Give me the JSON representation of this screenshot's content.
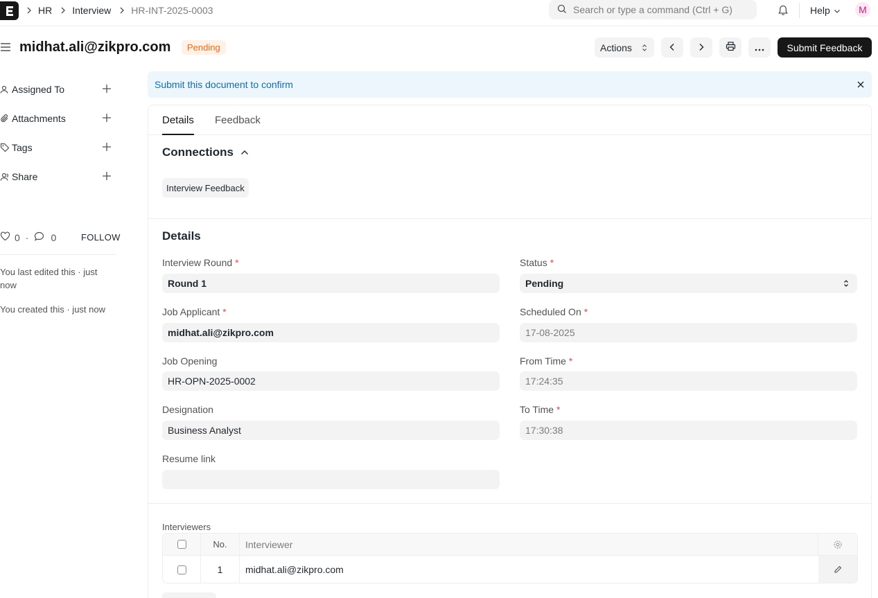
{
  "navbar": {
    "breadcrumbs": [
      "HR",
      "Interview",
      "HR-INT-2025-0003"
    ],
    "search_placeholder": "Search or type a command (Ctrl + G)",
    "help_label": "Help",
    "avatar_initial": "M"
  },
  "header": {
    "title": "midhat.ali@zikpro.com",
    "status": "Pending",
    "actions_label": "Actions",
    "primary_label": "Submit Feedback"
  },
  "sidebar": {
    "items": [
      {
        "label": "Assigned To",
        "icon": "assign-icon"
      },
      {
        "label": "Attachments",
        "icon": "paperclip-icon"
      },
      {
        "label": "Tags",
        "icon": "tag-icon"
      },
      {
        "label": "Share",
        "icon": "share-icon"
      }
    ],
    "likes_count": "0",
    "comments_count": "0",
    "follow_label": "FOLLOW",
    "timeline": [
      "You last edited this · just now",
      "You created this · just now"
    ]
  },
  "alert": {
    "message": "Submit this document to confirm"
  },
  "tabs": [
    "Details",
    "Feedback"
  ],
  "connections": {
    "title": "Connections",
    "chips": [
      "Interview Feedback"
    ]
  },
  "details": {
    "title": "Details",
    "fields": {
      "interview_round": {
        "label": "Interview Round",
        "value": "Round 1",
        "required": "*"
      },
      "status": {
        "label": "Status",
        "value": "Pending",
        "required": "*"
      },
      "job_applicant": {
        "label": "Job Applicant",
        "value": "midhat.ali@zikpro.com",
        "required": "*"
      },
      "scheduled_on": {
        "label": "Scheduled On",
        "value": "17-08-2025",
        "required": "*"
      },
      "job_opening": {
        "label": "Job Opening",
        "value": "HR-OPN-2025-0002"
      },
      "from_time": {
        "label": "From Time",
        "value": "17:24:35",
        "required": "*"
      },
      "designation": {
        "label": "Designation",
        "value": "Business Analyst"
      },
      "to_time": {
        "label": "To Time",
        "value": "17:30:38",
        "required": "*"
      },
      "resume_link": {
        "label": "Resume link",
        "value": ""
      }
    }
  },
  "interviewers": {
    "label": "Interviewers",
    "columns": [
      "No.",
      "Interviewer"
    ],
    "rows": [
      {
        "no": "1",
        "interviewer": "midhat.ali@zikpro.com"
      }
    ]
  },
  "colors": {
    "primary": "#171717",
    "status_pending_bg": "#fff1e7",
    "status_pending_fg": "#e86c13",
    "alert_bg": "#edf6fd",
    "alert_fg": "#0a6fb7",
    "required": "#e24c4c"
  }
}
